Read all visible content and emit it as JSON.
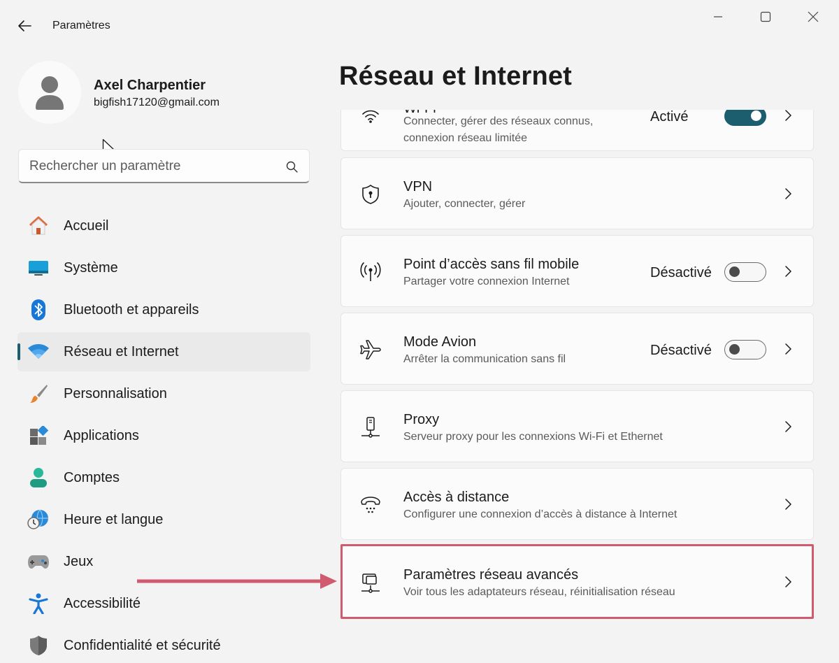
{
  "window": {
    "app_title": "Paramètres"
  },
  "profile": {
    "name": "Axel Charpentier",
    "email": "bigfish17120@gmail.com"
  },
  "search": {
    "placeholder": "Rechercher un paramètre"
  },
  "sidebar": {
    "items": [
      {
        "label": "Accueil",
        "icon": "home-icon",
        "active": false
      },
      {
        "label": "Système",
        "icon": "monitor-icon",
        "active": false
      },
      {
        "label": "Bluetooth et appareils",
        "icon": "bluetooth-icon",
        "active": false
      },
      {
        "label": "Réseau et Internet",
        "icon": "wifi-icon",
        "active": true
      },
      {
        "label": "Personnalisation",
        "icon": "brush-icon",
        "active": false
      },
      {
        "label": "Applications",
        "icon": "apps-icon",
        "active": false
      },
      {
        "label": "Comptes",
        "icon": "account-icon",
        "active": false
      },
      {
        "label": "Heure et langue",
        "icon": "globe-clock-icon",
        "active": false
      },
      {
        "label": "Jeux",
        "icon": "gamepad-icon",
        "active": false
      },
      {
        "label": "Accessibilité",
        "icon": "accessibility-icon",
        "active": false
      },
      {
        "label": "Confidentialité et sécurité",
        "icon": "shield-icon",
        "active": false
      }
    ],
    "accent_color": "#1d5e6e"
  },
  "main": {
    "title": "Réseau et Internet",
    "cards": [
      {
        "title": "Wi-Fi",
        "subtitle": "Connecter, gérer des réseaux connus, connexion réseau limitée",
        "subtitle_line1": "Connecter, gérer des réseaux connus,",
        "subtitle_line2": "connexion réseau limitée",
        "state": "Activé",
        "toggle_on": true,
        "icon": "wifi-icon"
      },
      {
        "title": "VPN",
        "subtitle": "Ajouter, connecter, gérer",
        "icon": "vpn-shield-icon"
      },
      {
        "title": "Point d’accès sans fil mobile",
        "subtitle": "Partager votre connexion Internet",
        "state": "Désactivé",
        "toggle_on": false,
        "icon": "hotspot-icon"
      },
      {
        "title": "Mode Avion",
        "subtitle": "Arrêter la communication sans fil",
        "state": "Désactivé",
        "toggle_on": false,
        "icon": "airplane-icon"
      },
      {
        "title": "Proxy",
        "subtitle": "Serveur proxy pour les connexions Wi-Fi et Ethernet",
        "icon": "proxy-icon"
      },
      {
        "title": "Accès à distance",
        "subtitle": "Configurer une connexion d’accès à distance à Internet",
        "icon": "dialup-icon"
      },
      {
        "title": "Paramètres réseau avancés",
        "subtitle": "Voir tous les adaptateurs réseau, réinitialisation réseau",
        "icon": "network-pc-icon",
        "highlighted": true
      }
    ]
  },
  "annotation": {
    "highlight_color": "#d05a6e"
  }
}
